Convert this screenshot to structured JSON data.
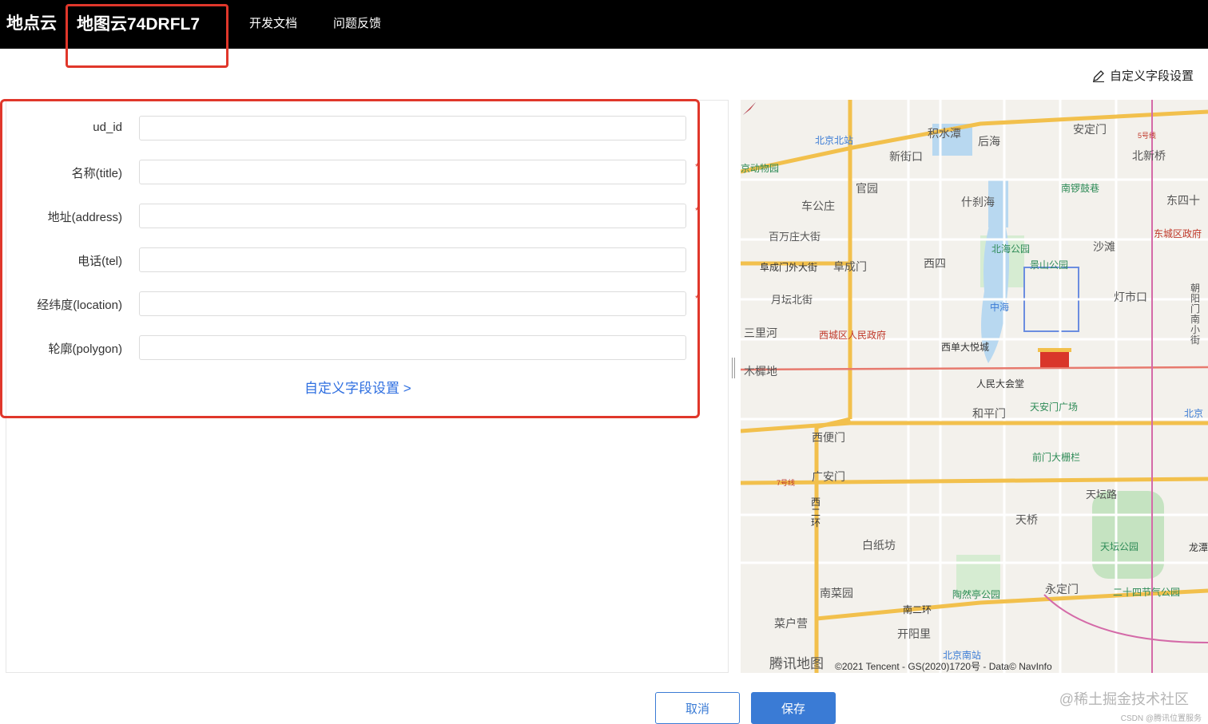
{
  "nav": {
    "brand": "地点云",
    "map_name": "地图云74DRFL7",
    "docs": "开发文档",
    "feedback": "问题反馈"
  },
  "toolbar": {
    "custom_fields": "自定义字段设置",
    "icon": "pencil-icon"
  },
  "form": {
    "fields": [
      {
        "label": "ud_id",
        "value": "",
        "required": false
      },
      {
        "label": "名称(title)",
        "value": "",
        "required": true
      },
      {
        "label": "地址(address)",
        "value": "",
        "required": true
      },
      {
        "label": "电话(tel)",
        "value": "",
        "required": false
      },
      {
        "label": "经纬度(location)",
        "value": "",
        "required": true
      },
      {
        "label": "轮廓(polygon)",
        "value": "",
        "required": false
      }
    ],
    "required_mark": "*",
    "custom_link": "自定义字段设置 >"
  },
  "map": {
    "logo": "腾讯地图",
    "copyright": "©2021 Tencent - GS(2020)1720号 - Data© NavInfo",
    "labels": {
      "l1": "北京北站",
      "l2": "积水潭",
      "l3": "后海",
      "l4": "安定门",
      "l5": "新街口",
      "l6": "北新桥",
      "l7": "京动物园",
      "l8": "官园",
      "l9": "南锣鼓巷",
      "l10": "车公庄",
      "l11": "什刹海",
      "l12": "东四十",
      "l13": "东城区政府",
      "l14": "百万庄大街",
      "l15": "沙滩",
      "l16": "北海公园",
      "l17": "阜成门外大街",
      "l18": "阜成门",
      "l19": "西四",
      "l20": "景山公园",
      "l21": "月坛北街",
      "l22": "中海",
      "l23": "灯市口",
      "l24": "三里河",
      "l25": "西城区人民政府",
      "l26": "西单大悦城",
      "l27": "木樨地",
      "l28": "人民大会堂",
      "l29": "天安门广场",
      "l30": "和平门",
      "l31": "北京",
      "l32": "西便门",
      "l33": "前门大栅栏",
      "l34": "广安门",
      "l35": "天坛路",
      "l36": "西二环",
      "l37": "天桥",
      "l38": "白纸坊",
      "l39": "天坛公园",
      "l40": "龙潭",
      "l41": "南菜园",
      "l42": "陶然亭公园",
      "l43": "永定门",
      "l44": "二十四节气公园",
      "l45": "南二环",
      "l46": "菜户营",
      "l47": "开阳里",
      "l48": "北京南站",
      "l49": "5号线",
      "l50": "7号线",
      "l51": "朝阳门南小街"
    }
  },
  "buttons": {
    "cancel": "取消",
    "save": "保存"
  },
  "watermark": {
    "main": "@稀土掘金技术社区",
    "sub": "CSDN @腾讯位置服务"
  }
}
